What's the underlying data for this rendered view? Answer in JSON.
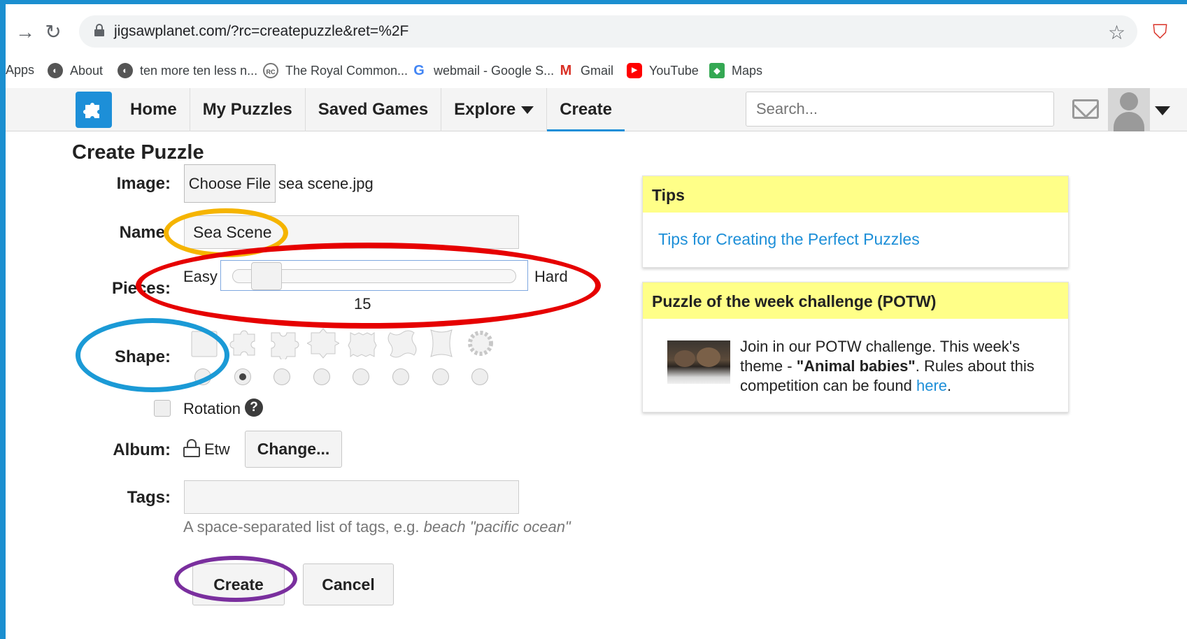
{
  "browser": {
    "url": "jigsawplanet.com/?rc=createpuzzle&ret=%2F",
    "bookmarks": [
      {
        "label": "Apps",
        "icon": "apps-icon"
      },
      {
        "label": "About",
        "icon": "globe-icon"
      },
      {
        "label": "ten more ten less n...",
        "icon": "globe-icon"
      },
      {
        "label": "The Royal Common...",
        "icon": "royal-commonwealth-icon"
      },
      {
        "label": "webmail - Google S...",
        "icon": "google-icon"
      },
      {
        "label": "Gmail",
        "icon": "gmail-icon"
      },
      {
        "label": "YouTube",
        "icon": "youtube-icon"
      },
      {
        "label": "Maps",
        "icon": "maps-icon"
      }
    ]
  },
  "header": {
    "nav": [
      {
        "label": "Home"
      },
      {
        "label": "My Puzzles"
      },
      {
        "label": "Saved Games"
      },
      {
        "label": "Explore",
        "dropdown": true
      },
      {
        "label": "Create",
        "active": true
      }
    ],
    "search_placeholder": "Search..."
  },
  "form": {
    "title": "Create Puzzle",
    "image_label": "Image:",
    "choose_file_label": "Choose File",
    "file_name": "sea scene.jpg",
    "name_label": "Name",
    "name_value": "Sea Scene",
    "pieces_label": "Pieces:",
    "easy_label": "Easy",
    "hard_label": "Hard",
    "pieces_value": "15",
    "shape_label": "Shape:",
    "shapes": [
      "square",
      "classic",
      "classic-2",
      "star-like",
      "jagged",
      "wavy",
      "curved",
      "gear"
    ],
    "selected_shape_index": 1,
    "rotation_label": "Rotation",
    "rotation_checked": false,
    "album_label": "Album:",
    "album_name": "Etw",
    "change_label": "Change...",
    "tags_label": "Tags:",
    "tags_value": "",
    "tags_hint": "A space-separated list of tags, e.g.",
    "tags_hint_example": "beach \"pacific ocean\"",
    "create_label": "Create",
    "cancel_label": "Cancel"
  },
  "tips": {
    "title": "Tips",
    "link": "Tips for Creating the Perfect Puzzles"
  },
  "potw": {
    "title": "Puzzle of the week challenge (POTW)",
    "text_1": "Join in our POTW challenge. This week's theme -",
    "theme": "\"Animal babies\"",
    "text_2": ". Rules about this competition can be found",
    "link": "here",
    "text_3": "."
  },
  "colors": {
    "accent": "#1d8fd8",
    "panel_header": "#ffff88",
    "annotation_orange": "#f5b400",
    "annotation_red": "#e60000",
    "annotation_blue": "#1b9ad6",
    "annotation_purple": "#7a2f9e",
    "background": "#1b8fd0"
  }
}
